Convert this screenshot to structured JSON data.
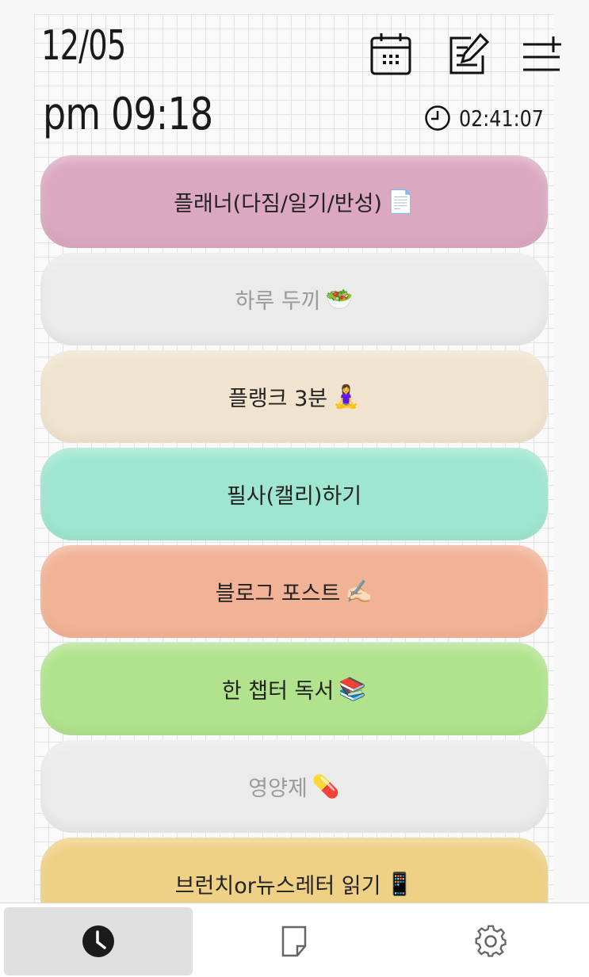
{
  "header": {
    "date": "12/05",
    "time": "pm 09:18",
    "timer": "02:41:07"
  },
  "icons": {
    "calendar": "calendar-icon",
    "edit": "edit-icon",
    "add_list": "add-list-icon",
    "timer": "clock-icon"
  },
  "habits": [
    {
      "label": "플래너(다짐/일기/반성)",
      "emoji": "📄",
      "color": "#dba8c0",
      "done": false
    },
    {
      "label": "하루 두끼",
      "emoji": "🥗",
      "color": "#ebebeb",
      "done": true
    },
    {
      "label": "플랭크 3분",
      "emoji": "🧘‍♀️",
      "color": "#f0e4cf",
      "done": false
    },
    {
      "label": "필사(캘리)하기",
      "emoji": "",
      "color": "#9fe6d0",
      "done": false
    },
    {
      "label": "블로그 포스트",
      "emoji": "✍🏻",
      "color": "#f2b295",
      "done": false
    },
    {
      "label": "한 챕터 독서",
      "emoji": "📚",
      "color": "#b1e38d",
      "done": false
    },
    {
      "label": "영양제",
      "emoji": "💊",
      "color": "#ebebeb",
      "done": true
    },
    {
      "label": "브런치or뉴스레터 읽기",
      "emoji": "📱",
      "color": "#efd185",
      "done": false
    }
  ],
  "bottom_nav": [
    {
      "name": "clock-tab",
      "icon": "clock-icon",
      "active": true
    },
    {
      "name": "note-tab",
      "icon": "note-icon",
      "active": false
    },
    {
      "name": "settings-tab",
      "icon": "gear-icon",
      "active": false
    }
  ]
}
